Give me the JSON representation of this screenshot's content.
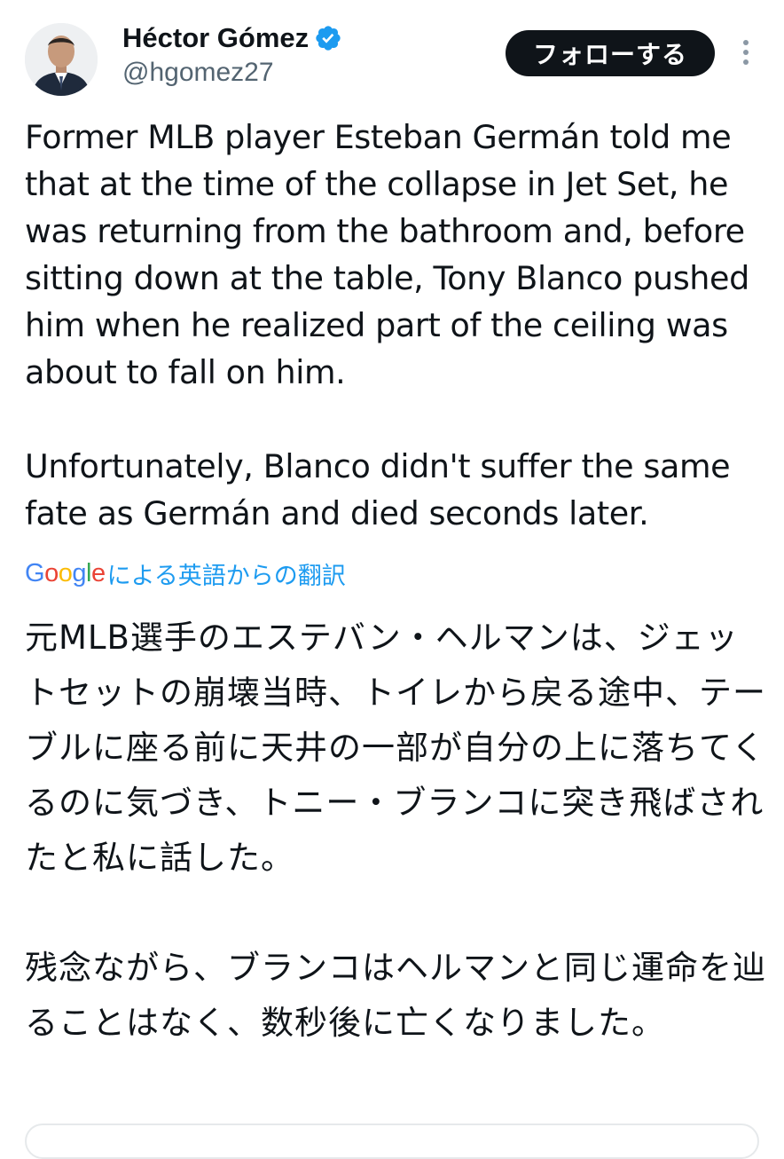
{
  "author": {
    "display_name": "Héctor Gómez",
    "handle": "@hgomez27",
    "verified": true,
    "avatar_icon": "avatar-photo"
  },
  "follow_button": {
    "label": "フォローする"
  },
  "more_icon": "more-vertical-icon",
  "tweet": {
    "text": "Former MLB player Esteban Germán told me that at the time of the collapse in Jet Set, he was returning from the bathroom and, before sitting down at the table, Tony Blanco pushed him when he realized part of the ceiling was about to fall on him.\n\nUnfortunately, Blanco didn't suffer the same fate as Germán and died seconds later."
  },
  "translation": {
    "provider": "Google",
    "label": "による英語からの翻訳",
    "text": "元MLB選手のエステバン・ヘルマンは、ジェットセットの崩壊当時、トイレから戻る途中、テーブルに座る前に天井の一部が自分の上に落ちてくるのに気づき、トニー・ブランコに突き飛ばされたと私に話した。\n\n残念ながら、ブランコはヘルマンと同じ運命を辿ることはなく、数秒後に亡くなりました。"
  },
  "colors": {
    "text_primary": "#0f1419",
    "text_secondary": "#536471",
    "link_blue": "#1d9bf0",
    "verified_blue": "#1d9bf0",
    "button_bg": "#0f1419",
    "google_blue": "#4285f4",
    "google_red": "#ea4335",
    "google_yellow": "#fbbc05",
    "google_green": "#34a853"
  }
}
